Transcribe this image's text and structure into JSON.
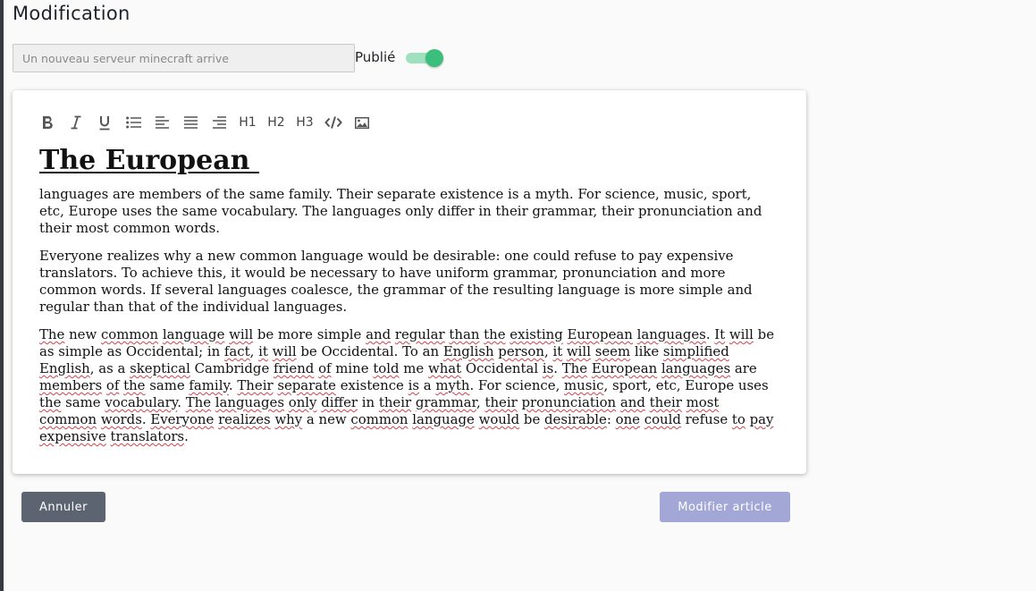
{
  "page": {
    "title": "Modification"
  },
  "form": {
    "title_placeholder": "Un nouveau serveur minecraft arrive",
    "title_value": "",
    "published_label": "Publié",
    "published": true
  },
  "toolbar": {
    "items": [
      {
        "name": "bold",
        "icon": "bold-icon"
      },
      {
        "name": "italic",
        "icon": "italic-icon"
      },
      {
        "name": "underline",
        "icon": "underline-icon"
      },
      {
        "name": "bullet-list",
        "icon": "bullet-list-icon"
      },
      {
        "name": "align-left",
        "icon": "align-left-icon"
      },
      {
        "name": "align-justify",
        "icon": "align-justify-icon"
      },
      {
        "name": "align-right",
        "icon": "align-right-icon"
      },
      {
        "name": "h1",
        "label": "H1"
      },
      {
        "name": "h2",
        "label": "H2"
      },
      {
        "name": "h3",
        "label": "H3"
      },
      {
        "name": "code",
        "icon": "code-icon"
      },
      {
        "name": "image",
        "icon": "image-icon"
      }
    ]
  },
  "editor": {
    "heading": "The European ",
    "paragraph1": "languages are members of the same family. Their separate existence is a myth. For science, music, sport, etc, Europe uses the same vocabulary. The languages only differ in their grammar, their pronunciation and their most common words.",
    "paragraph2": "Everyone realizes why a new common language would be desirable: one could refuse to pay expensive translators. To achieve this, it would be necessary to have uniform grammar, pronunciation and more common words. If several languages coalesce, the grammar of the resulting language is more simple and regular than that of the individual languages.",
    "paragraph3": [
      {
        "t": "The",
        "s": 1
      },
      {
        "t": " new ",
        "s": 0
      },
      {
        "t": "common",
        "s": 1
      },
      {
        "t": " ",
        "s": 0
      },
      {
        "t": "language",
        "s": 1
      },
      {
        "t": " ",
        "s": 0
      },
      {
        "t": "will",
        "s": 1
      },
      {
        "t": " be more simple ",
        "s": 0
      },
      {
        "t": "and",
        "s": 1
      },
      {
        "t": " ",
        "s": 0
      },
      {
        "t": "regular",
        "s": 1
      },
      {
        "t": " ",
        "s": 0
      },
      {
        "t": "than",
        "s": 1
      },
      {
        "t": " ",
        "s": 0
      },
      {
        "t": "the",
        "s": 1
      },
      {
        "t": " ",
        "s": 0
      },
      {
        "t": "existing",
        "s": 1
      },
      {
        "t": " ",
        "s": 0
      },
      {
        "t": "European",
        "s": 1
      },
      {
        "t": " ",
        "s": 0
      },
      {
        "t": "languages",
        "s": 1
      },
      {
        "t": ". ",
        "s": 0
      },
      {
        "t": "It",
        "s": 1
      },
      {
        "t": " ",
        "s": 0
      },
      {
        "t": "will",
        "s": 1
      },
      {
        "t": " be as simple as Occidental; in ",
        "s": 0
      },
      {
        "t": "fact",
        "s": 1
      },
      {
        "t": ", ",
        "s": 0
      },
      {
        "t": "it",
        "s": 1
      },
      {
        "t": " ",
        "s": 0
      },
      {
        "t": "will",
        "s": 1
      },
      {
        "t": " be Occidental. To an ",
        "s": 0
      },
      {
        "t": "English",
        "s": 1
      },
      {
        "t": " ",
        "s": 0
      },
      {
        "t": "person",
        "s": 1
      },
      {
        "t": ", ",
        "s": 0
      },
      {
        "t": "it",
        "s": 1
      },
      {
        "t": " ",
        "s": 0
      },
      {
        "t": "will",
        "s": 1
      },
      {
        "t": " ",
        "s": 0
      },
      {
        "t": "seem",
        "s": 1
      },
      {
        "t": " like ",
        "s": 0
      },
      {
        "t": "simplified",
        "s": 1
      },
      {
        "t": " ",
        "s": 0
      },
      {
        "t": "English",
        "s": 1
      },
      {
        "t": ", as a ",
        "s": 0
      },
      {
        "t": "skeptical",
        "s": 1
      },
      {
        "t": " Cambridge ",
        "s": 0
      },
      {
        "t": "friend",
        "s": 1
      },
      {
        "t": " ",
        "s": 0
      },
      {
        "t": "of",
        "s": 1
      },
      {
        "t": " mine ",
        "s": 0
      },
      {
        "t": "told",
        "s": 1
      },
      {
        "t": " me ",
        "s": 0
      },
      {
        "t": "what",
        "s": 1
      },
      {
        "t": " Occidental ",
        "s": 0
      },
      {
        "t": "is",
        "s": 1
      },
      {
        "t": ". ",
        "s": 0
      },
      {
        "t": "The",
        "s": 1
      },
      {
        "t": " ",
        "s": 0
      },
      {
        "t": "European",
        "s": 1
      },
      {
        "t": " ",
        "s": 0
      },
      {
        "t": "languages",
        "s": 1
      },
      {
        "t": " are ",
        "s": 0
      },
      {
        "t": "members",
        "s": 1
      },
      {
        "t": " ",
        "s": 0
      },
      {
        "t": "of",
        "s": 1
      },
      {
        "t": " ",
        "s": 0
      },
      {
        "t": "the",
        "s": 1
      },
      {
        "t": " same ",
        "s": 0
      },
      {
        "t": "family",
        "s": 1
      },
      {
        "t": ". ",
        "s": 0
      },
      {
        "t": "Their",
        "s": 1
      },
      {
        "t": " ",
        "s": 0
      },
      {
        "t": "separate",
        "s": 1
      },
      {
        "t": " existence ",
        "s": 0
      },
      {
        "t": "is",
        "s": 1
      },
      {
        "t": " a ",
        "s": 0
      },
      {
        "t": "myth",
        "s": 1
      },
      {
        "t": ". For science, ",
        "s": 0
      },
      {
        "t": "music",
        "s": 1
      },
      {
        "t": ", sport, etc, Europe uses ",
        "s": 0
      },
      {
        "t": "the",
        "s": 1
      },
      {
        "t": " same ",
        "s": 0
      },
      {
        "t": "vocabulary",
        "s": 1
      },
      {
        "t": ". ",
        "s": 0
      },
      {
        "t": "The",
        "s": 1
      },
      {
        "t": " ",
        "s": 0
      },
      {
        "t": "languages",
        "s": 1
      },
      {
        "t": " ",
        "s": 0
      },
      {
        "t": "only",
        "s": 1
      },
      {
        "t": " ",
        "s": 0
      },
      {
        "t": "differ",
        "s": 1
      },
      {
        "t": " in ",
        "s": 0
      },
      {
        "t": "their",
        "s": 1
      },
      {
        "t": " ",
        "s": 0
      },
      {
        "t": "grammar",
        "s": 1
      },
      {
        "t": ", ",
        "s": 0
      },
      {
        "t": "their",
        "s": 1
      },
      {
        "t": " ",
        "s": 0
      },
      {
        "t": "pronunciation",
        "s": 1
      },
      {
        "t": " ",
        "s": 0
      },
      {
        "t": "and",
        "s": 1
      },
      {
        "t": " ",
        "s": 0
      },
      {
        "t": "their",
        "s": 1
      },
      {
        "t": " ",
        "s": 0
      },
      {
        "t": "most",
        "s": 1
      },
      {
        "t": " ",
        "s": 0
      },
      {
        "t": "common",
        "s": 1
      },
      {
        "t": " ",
        "s": 0
      },
      {
        "t": "words",
        "s": 1
      },
      {
        "t": ". ",
        "s": 0
      },
      {
        "t": "Everyone",
        "s": 1
      },
      {
        "t": " ",
        "s": 0
      },
      {
        "t": "realizes",
        "s": 1
      },
      {
        "t": " ",
        "s": 0
      },
      {
        "t": "why",
        "s": 1
      },
      {
        "t": " a new ",
        "s": 0
      },
      {
        "t": "common",
        "s": 1
      },
      {
        "t": " ",
        "s": 0
      },
      {
        "t": "language",
        "s": 1
      },
      {
        "t": " ",
        "s": 0
      },
      {
        "t": "would",
        "s": 1
      },
      {
        "t": " be ",
        "s": 0
      },
      {
        "t": "desirable",
        "s": 1
      },
      {
        "t": ": ",
        "s": 0
      },
      {
        "t": "one",
        "s": 1
      },
      {
        "t": " ",
        "s": 0
      },
      {
        "t": "could",
        "s": 1
      },
      {
        "t": " refuse ",
        "s": 0
      },
      {
        "t": "to",
        "s": 1
      },
      {
        "t": " ",
        "s": 0
      },
      {
        "t": "pay",
        "s": 1
      },
      {
        "t": " ",
        "s": 0
      },
      {
        "t": "expensive",
        "s": 1
      },
      {
        "t": " ",
        "s": 0
      },
      {
        "t": "translators",
        "s": 1
      },
      {
        "t": ".",
        "s": 0
      }
    ]
  },
  "actions": {
    "cancel_label": "Annuler",
    "submit_label": "Modifier article"
  },
  "colors": {
    "toggle_on": "#3cbf7c",
    "cancel_button": "#5b6470",
    "submit_button": "#a3a7d6",
    "spellcheck": "#d2404a"
  }
}
